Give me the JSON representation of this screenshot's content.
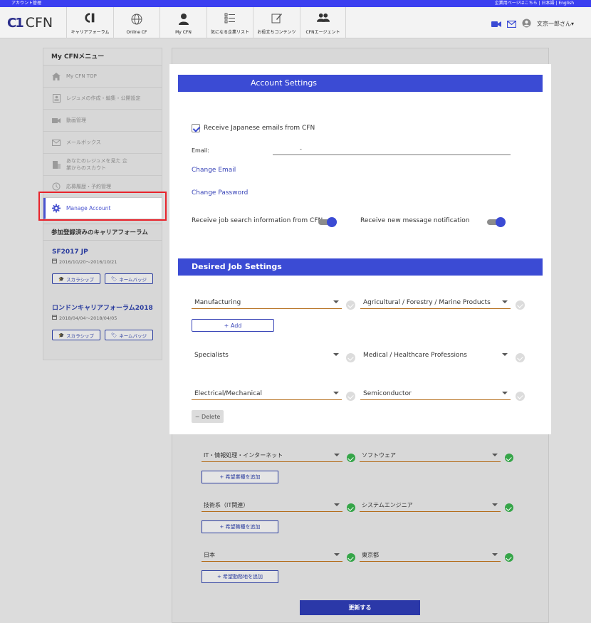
{
  "topbar": {
    "left": "アカウント管理",
    "right": "企業用ページはこちら | 日本語 | English"
  },
  "header": {
    "logo_mark": "C1",
    "logo_text": "CFN",
    "nav": [
      {
        "label": "キャリアフォーラム",
        "icon": "cfn-logo-icon"
      },
      {
        "label": "Online CF",
        "icon": "globe-icon"
      },
      {
        "label": "My CFN",
        "icon": "person-icon"
      },
      {
        "label": "気になる企業リスト",
        "icon": "list-icon"
      },
      {
        "label": "お役立ちコンテンツ",
        "icon": "edit-icon"
      },
      {
        "label": "CFNエージェント",
        "icon": "group-icon"
      }
    ],
    "user_name": "文京一郎さん▾"
  },
  "sidebar": {
    "title": "My CFNメニュー",
    "items": [
      {
        "label": "My CFN TOP",
        "icon": "home-icon"
      },
      {
        "label": "レジュメの作成・編集・公開設定",
        "icon": "resume-icon"
      },
      {
        "label": "動画管理",
        "icon": "video-icon"
      },
      {
        "label": "メールボックス",
        "icon": "mail-icon"
      },
      {
        "label": "あなたのレジュメを見た 企業からのスカウト",
        "icon": "building-icon"
      },
      {
        "label": "応募履歴・予約管理",
        "icon": "history-icon"
      },
      {
        "label": "Manage Account",
        "icon": "gear-icon"
      }
    ],
    "forums_title": "参加登録済みのキャリアフォーラム",
    "forums": [
      {
        "name": "SF2017 JP",
        "dates": "2016/10/20〜2016/10/21",
        "btn1": "スカラシップ",
        "btn2": "ネームバッジ"
      },
      {
        "name": "ロンドンキャリアフォーラム2018",
        "dates": "2018/04/04〜2018/04/05",
        "btn1": "スカラシップ",
        "btn2": "ネームバッジ"
      }
    ]
  },
  "main_jp": {
    "rows": [
      {
        "a": "IT・情報処理・インターネット",
        "b": "ソフトウェア"
      },
      {
        "a": "技術系（IT関連）",
        "b": "システムエンジニア"
      },
      {
        "a": "日本",
        "b": "東京都"
      }
    ],
    "add_buttons": [
      "+ 希望業種を追加",
      "+ 希望職種を追加",
      "+ 希望勤務地を追加"
    ],
    "update": "更新する"
  },
  "popup": {
    "account_title": "Account Settings",
    "receive_jp": "Receive Japanese emails from CFN",
    "email_label": "Email:",
    "email_value": "-",
    "change_email": "Change Email",
    "change_password": "Change Password",
    "job_info": "Receive job search information from CFN",
    "msg_notif": "Receive new message notification",
    "desired_title": "Desired Job Settings",
    "sel1a": "Manufacturing",
    "sel1b": "Agricultural / Forestry / Marine Products",
    "add": "+ Add",
    "sel2a": "Specialists",
    "sel2b": "Medical / Healthcare Professions",
    "sel3a": "Electrical/Mechanical",
    "sel3b": "Semiconductor",
    "delete": "− Delete"
  },
  "colors": {
    "accent": "#3b4bd4",
    "link": "#3a46b8",
    "highlight": "#e8232b",
    "check_green": "#35a548"
  }
}
